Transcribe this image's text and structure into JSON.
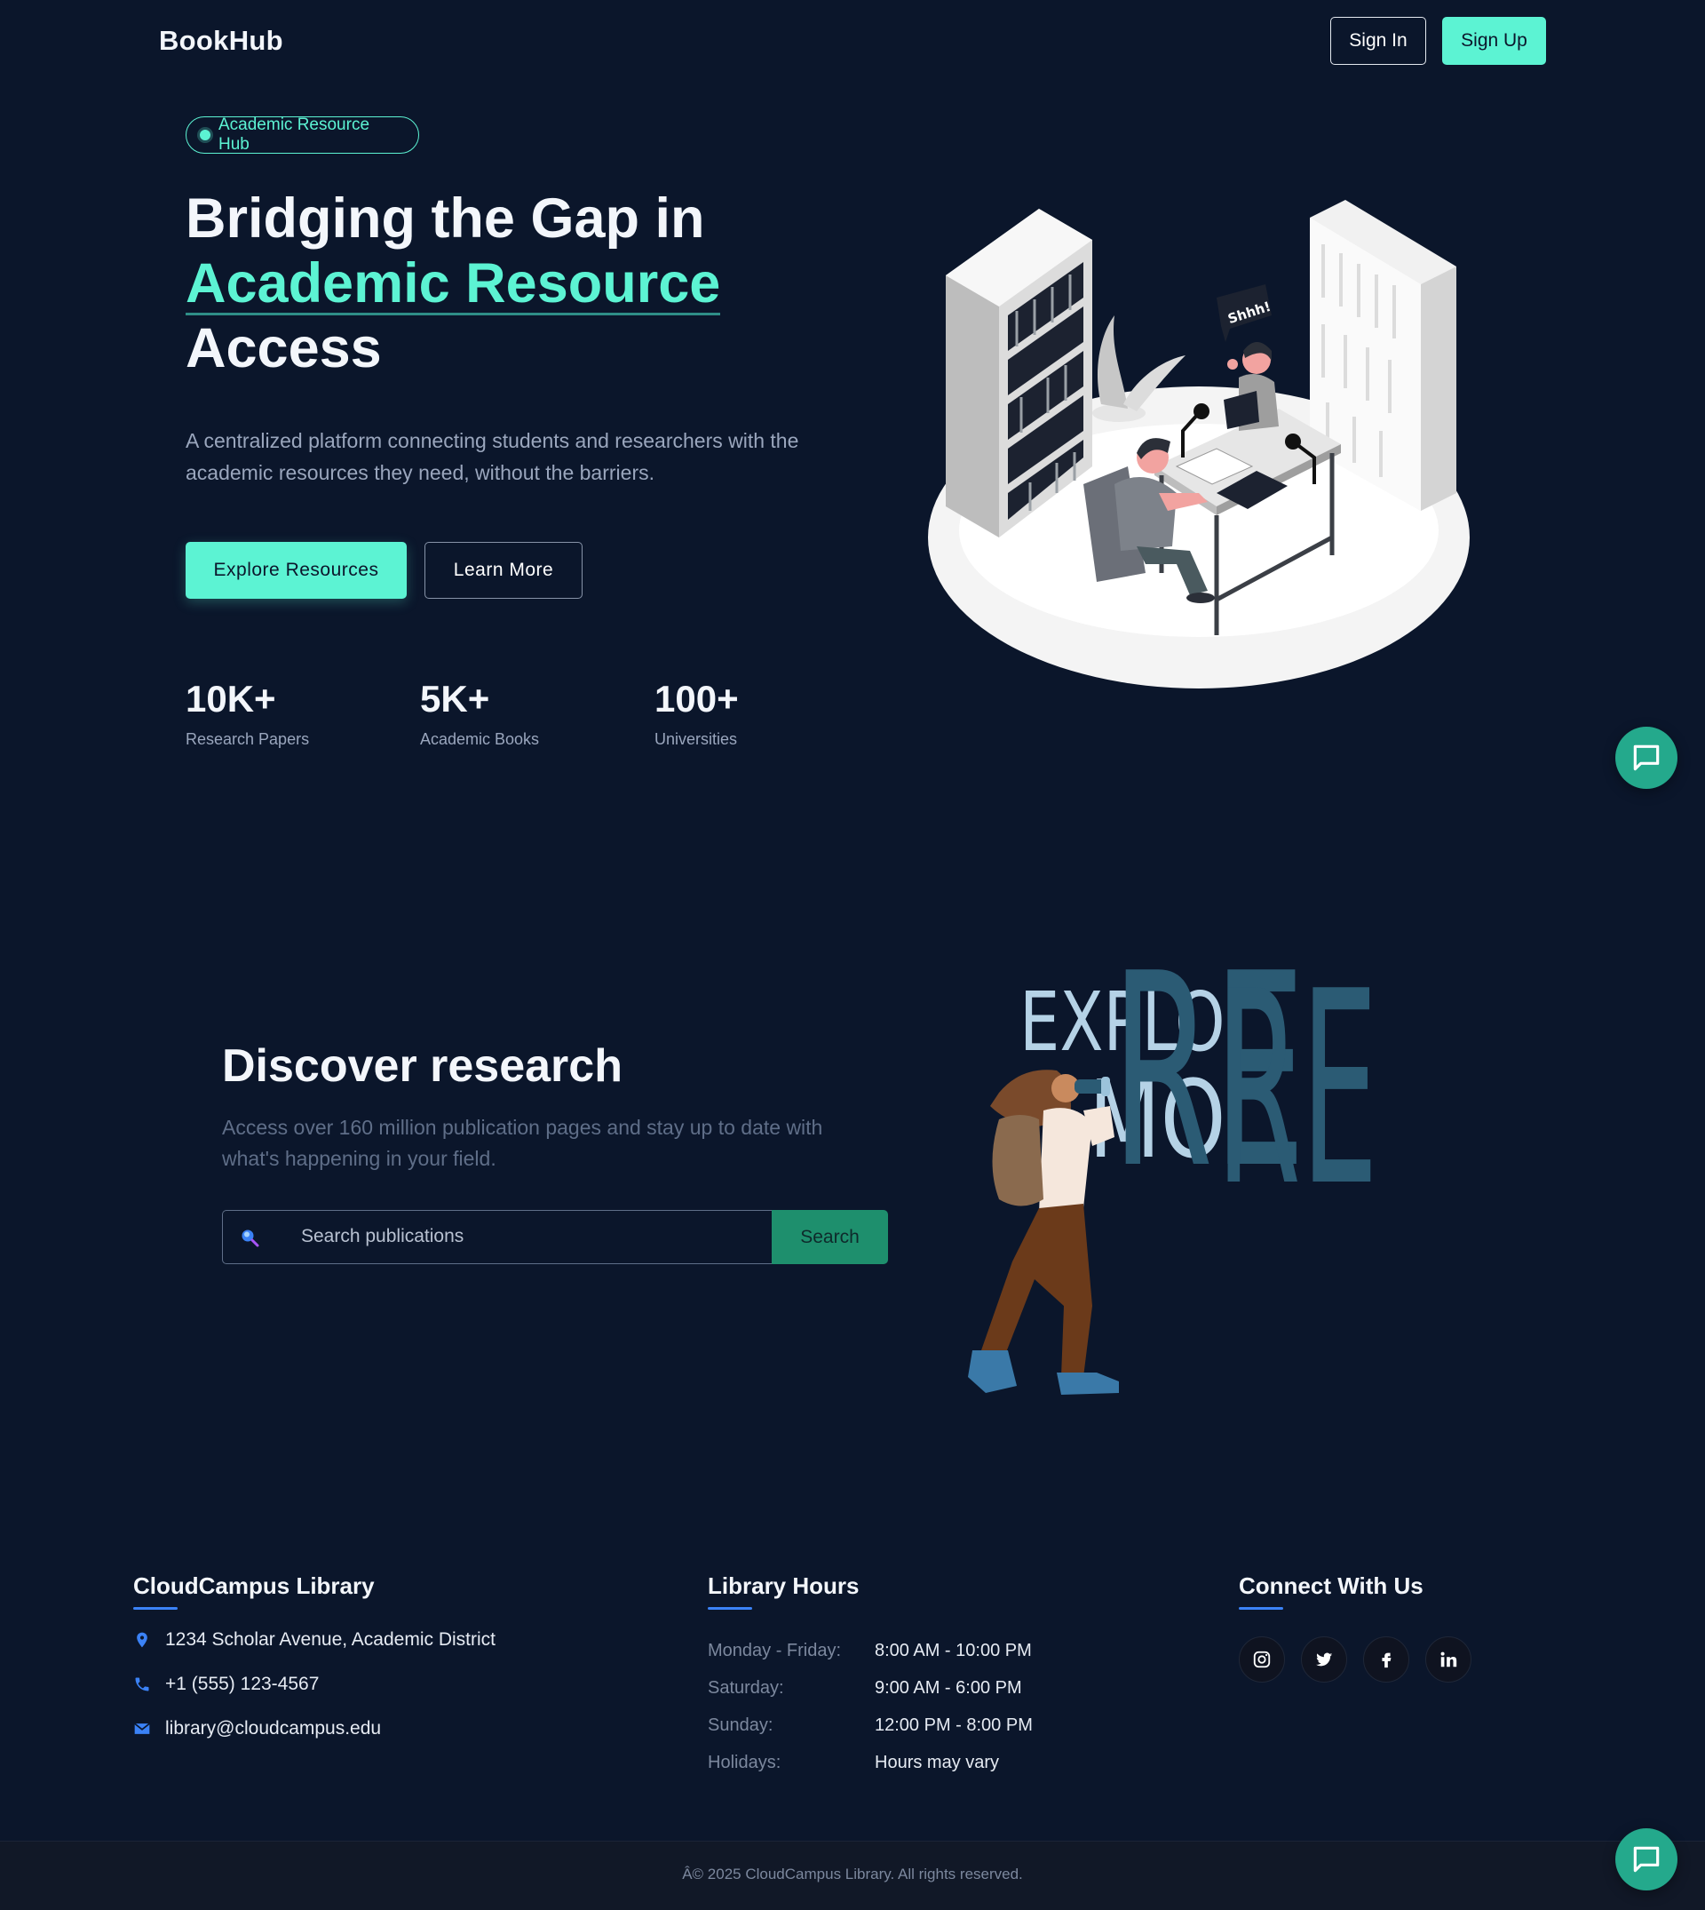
{
  "nav": {
    "brand": "BookHub",
    "signin_label": "Sign In",
    "signup_label": "Sign Up"
  },
  "hero": {
    "badge": "Academic Resource Hub",
    "title_line1": "Bridging the Gap in",
    "title_accent": "Academic Resource",
    "title_line3": "Access",
    "description": "A centralized platform connecting students and researchers with the academic resources they need, without the barriers.",
    "primary_button": "Explore Resources",
    "secondary_button": "Learn More",
    "stats": [
      {
        "value": "10K+",
        "label": "Research Papers"
      },
      {
        "value": "5K+",
        "label": "Academic Books"
      },
      {
        "value": "100+",
        "label": "Universities"
      }
    ],
    "illustration_bubble": "Shhh!"
  },
  "discover": {
    "title": "Discover research",
    "description": "Access over 160 million publication pages and stay up to date with what's happening in your field.",
    "search_placeholder": "Search publications",
    "search_button": "Search",
    "illustration_words": [
      "EXPLO",
      "MO",
      "RE",
      "RE"
    ]
  },
  "footer": {
    "library": {
      "title": "CloudCampus Library",
      "address": "1234 Scholar Avenue, Academic District",
      "phone": "+1 (555) 123-4567",
      "email": "library@cloudcampus.edu"
    },
    "hours": {
      "title": "Library Hours",
      "rows": [
        {
          "day": "Monday - Friday:",
          "time": "8:00 AM - 10:00 PM"
        },
        {
          "day": "Saturday:",
          "time": "9:00 AM - 6:00 PM"
        },
        {
          "day": "Sunday:",
          "time": "12:00 PM - 8:00 PM"
        },
        {
          "day": "Holidays:",
          "time": "Hours may vary"
        }
      ]
    },
    "connect": {
      "title": "Connect With Us",
      "socials": [
        "instagram-icon",
        "twitter-icon",
        "facebook-icon",
        "linkedin-icon"
      ]
    },
    "copyright": "Â© 2025 CloudCampus Library. All rights reserved."
  },
  "colors": {
    "background": "#0b162b",
    "accent": "#5cf3d3",
    "search_button": "#1e8f6d",
    "chat_button": "#24a98c",
    "footer_underline": "#3b82f6"
  }
}
